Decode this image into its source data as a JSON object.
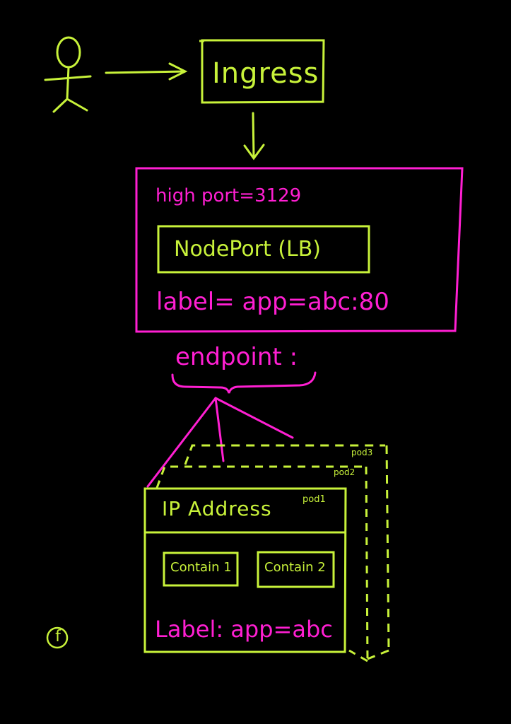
{
  "colors": {
    "background": "#000000",
    "green": "#c8f23a",
    "magenta": "#ff1fd2"
  },
  "ingress": {
    "label": "Ingress"
  },
  "service": {
    "high_port": "high port=3129",
    "nodeport_label": "NodePort (LB)",
    "selector": "label= app=abc:80"
  },
  "endpoint": {
    "label": "endpoint :"
  },
  "pods": {
    "pod1_tag": "pod1",
    "pod2_tag": "pod2",
    "pod3_tag": "pod3",
    "ip_address": "IP Address",
    "container1": "Contain 1",
    "container2": "Contain 2",
    "label": "Label: app=abc"
  },
  "logo": {
    "glyph": "f"
  }
}
